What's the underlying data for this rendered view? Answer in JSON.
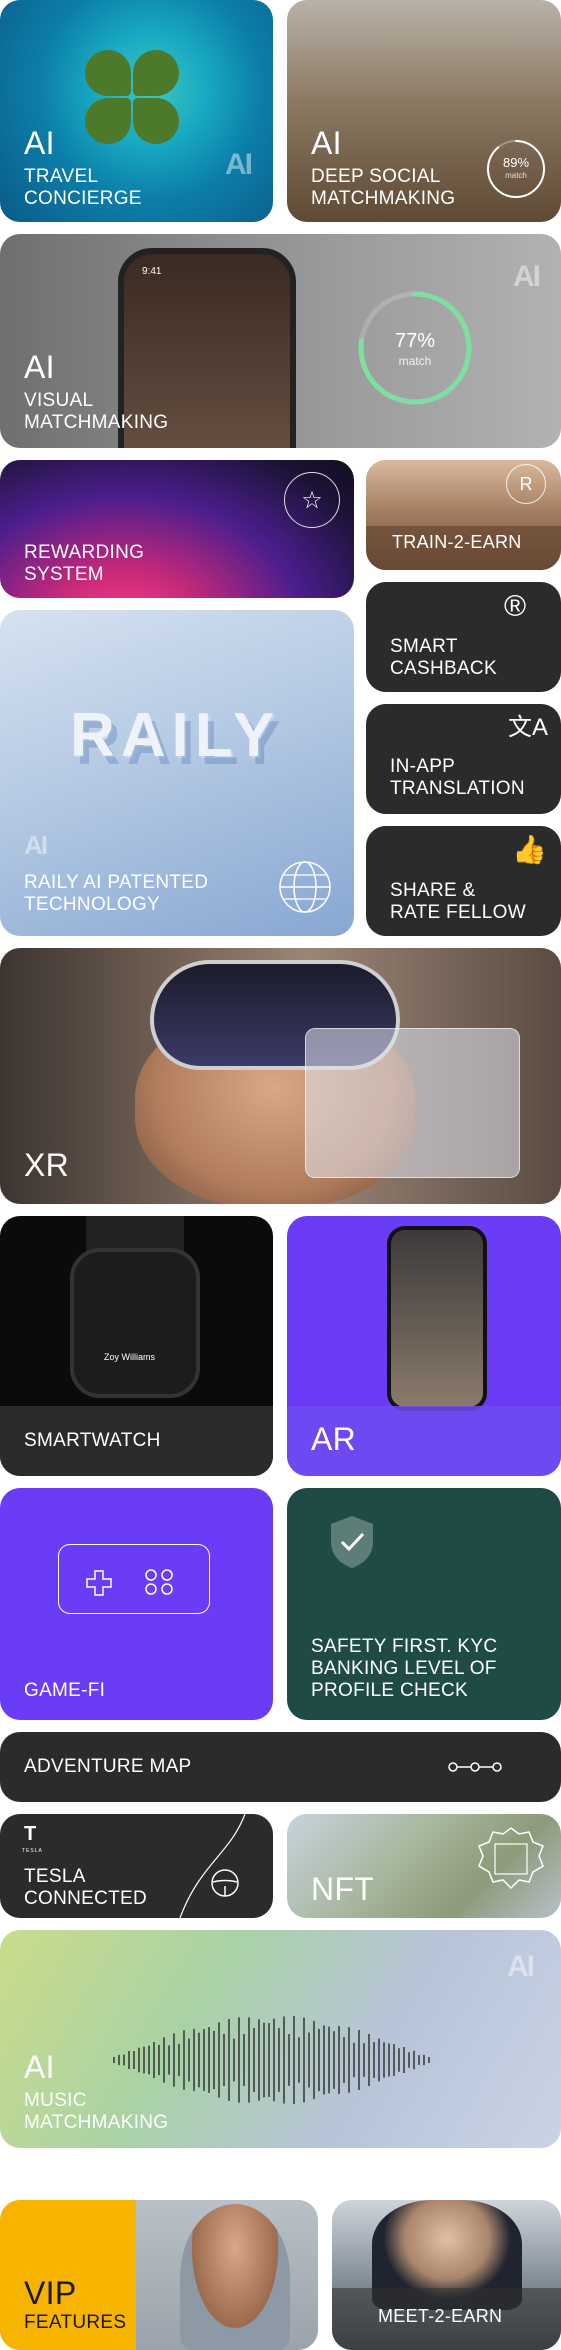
{
  "cards": {
    "travel": {
      "ai": "AI",
      "line1": "TRAVEL",
      "line2": "CONCIERGE",
      "logo": "AI"
    },
    "deep": {
      "ai": "AI",
      "line1": "DEEP SOCIAL",
      "line2": "MATCHMAKING",
      "pct": "89%",
      "pct_label": "match",
      "match_fraction": 0.89
    },
    "visual": {
      "ai": "AI",
      "line1": "VISUAL",
      "line2": "MATCHMAKING",
      "pct": "77%",
      "pct_label": "match",
      "match_fraction": 0.77,
      "phone_time": "9:41",
      "logo": "AI"
    },
    "reward": {
      "line1": "REWARDING",
      "line2": "SYSTEM"
    },
    "train": {
      "label": "TRAIN-2-EARN"
    },
    "raily": {
      "word": "RAILY",
      "line1": "RAILY AI PATENTED",
      "line2": "TECHNOLOGY",
      "logo": "AI"
    },
    "cashback": {
      "line1": "SMART",
      "line2": "CASHBACK"
    },
    "translation": {
      "line1": "IN-APP",
      "line2": "TRANSLATION"
    },
    "share": {
      "line1": "SHARE &",
      "line2": "RATE FELLOW"
    },
    "xr": {
      "label": "XR"
    },
    "watch": {
      "label": "SMARTWATCH",
      "user_name": "Zoy Williams"
    },
    "ar": {
      "label": "AR"
    },
    "game": {
      "label": "GAME-FI"
    },
    "safety": {
      "line1": "SAFETY FIRST. KYC",
      "line2": "BANKING LEVEL OF",
      "line3": "PROFILE CHECK"
    },
    "map": {
      "label": "ADVENTURE MAP"
    },
    "tesla": {
      "brand": "TESLA",
      "line1": "TESLA",
      "line2": "CONNECTED"
    },
    "nft": {
      "label": "NFT"
    },
    "music": {
      "ai": "AI",
      "line1": "MUSIC",
      "line2": "MATCHMAKING",
      "logo": "AI"
    },
    "vip": {
      "line1": "VIP",
      "line2": "FEATURES"
    },
    "meet": {
      "label": "MEET-2-EARN"
    }
  },
  "colors": {
    "purple": "#6b3cf5",
    "dark": "#2b2b2b",
    "safety_green": "#1f4b46",
    "vip_yellow": "#f6b300",
    "match_ring": "#7ee0a0"
  },
  "icons": [
    "star-icon",
    "r-coin-icon",
    "cashback-hand-icon",
    "translate-icon",
    "thumbs-up-icon",
    "globe-icon",
    "gamepad-icon",
    "shield-check-icon",
    "route-dots-icon",
    "tesla-logo-icon",
    "steering-wheel-icon",
    "nft-frame-icon",
    "sound-wave-icon"
  ]
}
